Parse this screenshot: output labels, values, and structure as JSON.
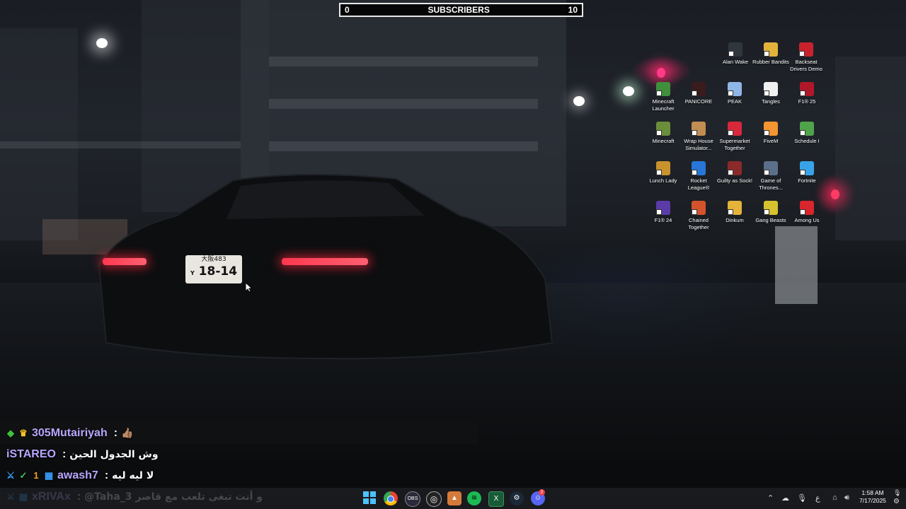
{
  "subscriber_bar": {
    "left": "0",
    "label": "SUBSCRIBERS",
    "right": "10"
  },
  "plate": {
    "top": "大阪483",
    "number": "18-14",
    "prefix": "Y"
  },
  "desktop_icons": [
    {
      "label": "Alan Wake",
      "icon": "alan-wake-icon",
      "color": "#30363d"
    },
    {
      "label": "Rubber Bandits",
      "icon": "rubber-bandits-icon",
      "color": "#e2b33b"
    },
    {
      "label": "Backseat Drivers Demo",
      "icon": "backseat-drivers-icon",
      "color": "#c9222d"
    },
    {
      "label": "Minecraft Launcher",
      "icon": "minecraft-launcher-icon",
      "color": "#3f8f3c"
    },
    {
      "label": "PANICORE",
      "icon": "panicore-icon",
      "color": "#3a1c1c"
    },
    {
      "label": "PEAK",
      "icon": "peak-icon",
      "color": "#8fb6e6"
    },
    {
      "label": "Tangles",
      "icon": "tangles-icon",
      "color": "#f0f0f0"
    },
    {
      "label": "F1® 25",
      "icon": "f1-25-icon",
      "color": "#b0182a"
    },
    {
      "label": "Minecraft",
      "icon": "minecraft-icon",
      "color": "#6b8e3a"
    },
    {
      "label": "Wrap House Simulator...",
      "icon": "wrap-house-icon",
      "color": "#c28d52"
    },
    {
      "label": "Supermarket Together",
      "icon": "supermarket-together-icon",
      "color": "#d8283b"
    },
    {
      "label": "FiveM",
      "icon": "fivem-icon",
      "color": "#f39530"
    },
    {
      "label": "Schedule I",
      "icon": "schedule-i-icon",
      "color": "#4fa34a"
    },
    {
      "label": "Lunch Lady",
      "icon": "lunch-lady-icon",
      "color": "#c8922d"
    },
    {
      "label": "Rocket League®",
      "icon": "rocket-league-icon",
      "color": "#2876d8"
    },
    {
      "label": "Guilty as Sock!",
      "icon": "guilty-as-sock-icon",
      "color": "#8b2a2a"
    },
    {
      "label": "Game of Thrones...",
      "icon": "game-of-thrones-icon",
      "color": "#5c6f8a"
    },
    {
      "label": "Fortnite",
      "icon": "fortnite-icon",
      "color": "#38a3e8"
    },
    {
      "label": "F1® 24",
      "icon": "f1-24-icon",
      "color": "#5b3ba8"
    },
    {
      "label": "Chained Together",
      "icon": "chained-together-icon",
      "color": "#d4532d"
    },
    {
      "label": "Dinkum",
      "icon": "dinkum-icon",
      "color": "#e5b33a"
    },
    {
      "label": "Gang Beasts",
      "icon": "gang-beasts-icon",
      "color": "#d6c12e"
    },
    {
      "label": "Among Us",
      "icon": "among-us-icon",
      "color": "#d8262c"
    }
  ],
  "chat": [
    {
      "name": "305Mutairiyah",
      "message": "👍🏽",
      "badges": [
        "diamond-badge",
        "crown-badge"
      ]
    },
    {
      "name": "iSTAREO",
      "message": "وش الجدول الحين",
      "badges": []
    },
    {
      "name": "awash7",
      "message": "لا ليه ليه",
      "badges": [
        "sword-badge",
        "check-badge",
        "one-badge",
        "grid-badge"
      ]
    },
    {
      "name": "xRIVAx",
      "message": "@Taha_3 و أنت تبغى تلعب مع قاصر",
      "badges": [
        "sword-badge",
        "grid-badge"
      ]
    }
  ],
  "taskbar": {
    "apps": [
      "windows-start-icon",
      "chrome-icon",
      "obs-icon",
      "github-icon",
      "vlc-icon",
      "spotify-icon",
      "excel-icon",
      "steam-icon",
      "discord-icon"
    ],
    "discord_badge": "2",
    "tray_lang": "ع",
    "time": "1:58 AM",
    "date": "7/17/2025"
  },
  "colors": {
    "chat_name": "#b9a7ff",
    "taillight": "#ff3850"
  }
}
